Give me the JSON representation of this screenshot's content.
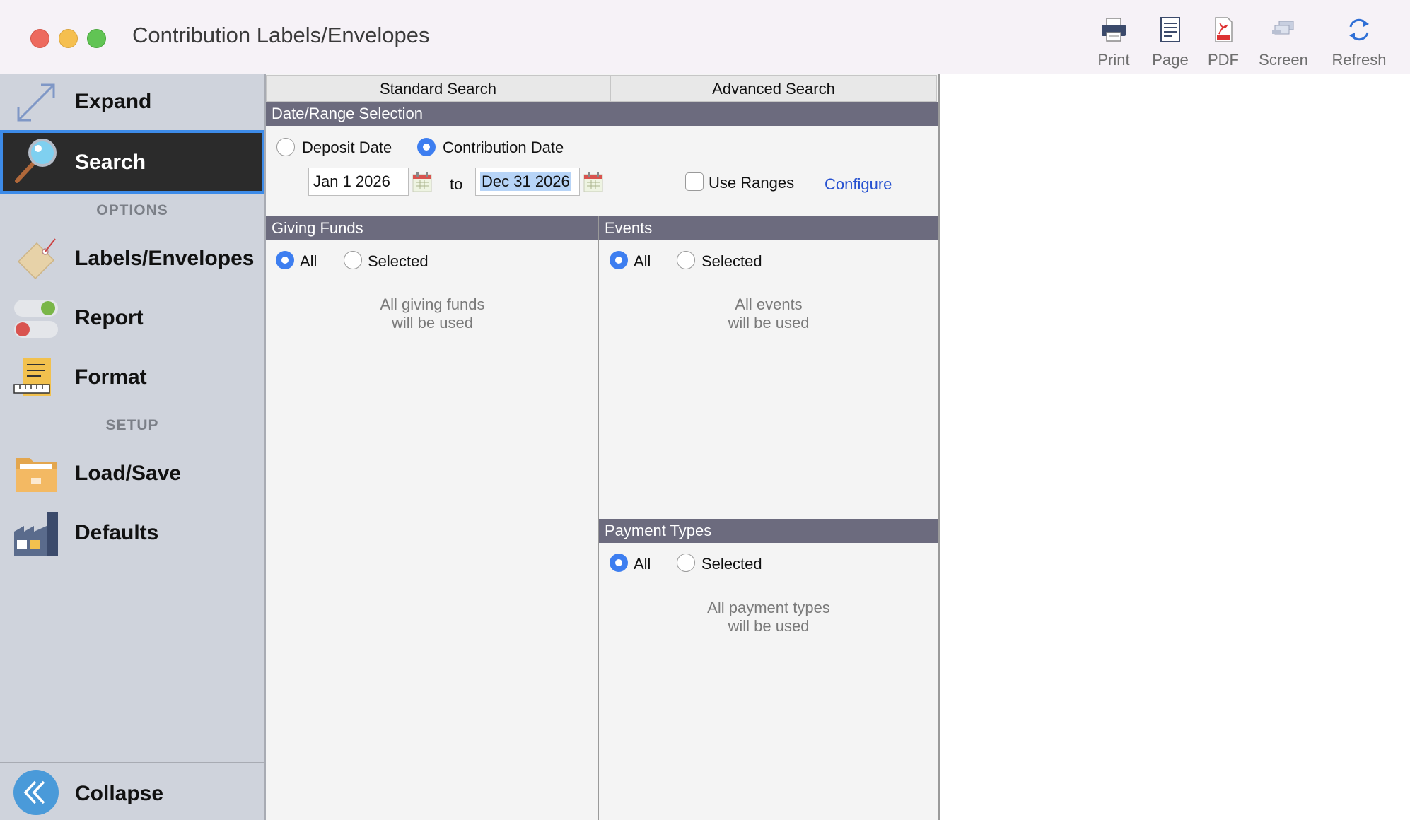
{
  "window": {
    "title": "Contribution Labels/Envelopes"
  },
  "toolbar": {
    "print": "Print",
    "page": "Page",
    "pdf": "PDF",
    "screen": "Screen",
    "refresh": "Refresh"
  },
  "sidebar": {
    "expand": "Expand",
    "search": "Search",
    "options_header": "OPTIONS",
    "labels_envelopes": "Labels/Envelopes",
    "report": "Report",
    "format": "Format",
    "setup_header": "SETUP",
    "load_save": "Load/Save",
    "defaults": "Defaults",
    "collapse": "Collapse"
  },
  "tabs": {
    "standard": "Standard Search",
    "advanced": "Advanced Search"
  },
  "date_range": {
    "header": "Date/Range Selection",
    "deposit_date": "Deposit Date",
    "contribution_date": "Contribution Date",
    "selected": "contribution_date",
    "from": "Jan 1 2026",
    "to_label": "to",
    "to": "Dec 31 2026",
    "use_ranges": "Use Ranges",
    "use_ranges_checked": false,
    "configure": "Configure"
  },
  "giving_funds": {
    "header": "Giving Funds",
    "all": "All",
    "selected": "Selected",
    "choice": "all",
    "note_line1": "All giving funds",
    "note_line2": "will be used"
  },
  "events": {
    "header": "Events",
    "all": "All",
    "selected": "Selected",
    "choice": "all",
    "note_line1": "All events",
    "note_line2": "will be used"
  },
  "payment_types": {
    "header": "Payment Types",
    "all": "All",
    "selected": "Selected",
    "choice": "all",
    "note_line1": "All payment types",
    "note_line2": "will be used"
  },
  "colors": {
    "accent": "#3d7ef0",
    "section_header": "#6c6b7e",
    "sidebar_bg": "#cfd3dc",
    "active_item_bg": "#2b2b2b",
    "active_item_border": "#3d8be8",
    "link": "#2651d0"
  }
}
